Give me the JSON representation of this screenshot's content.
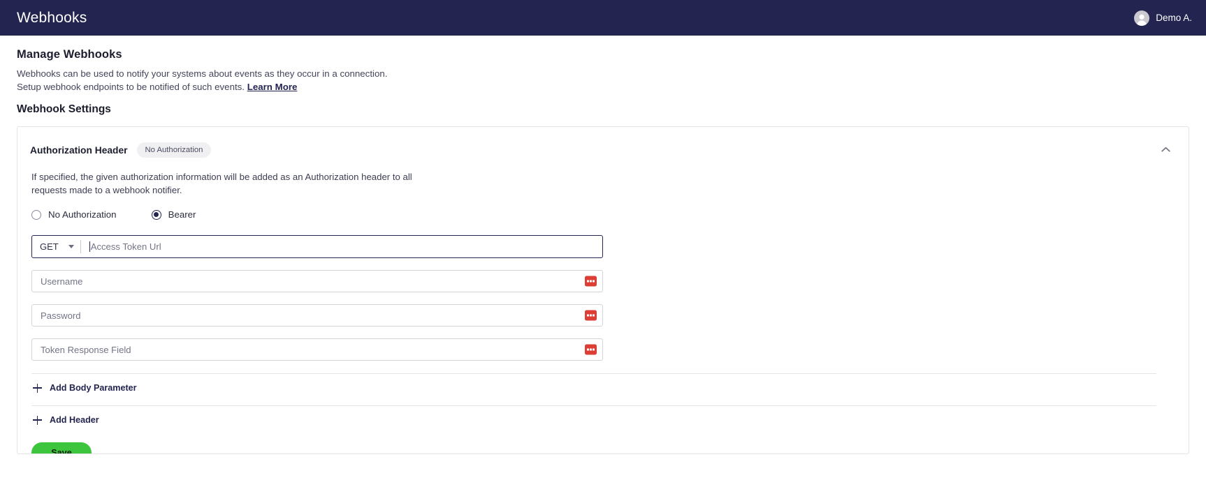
{
  "topbar": {
    "title": "Webhooks",
    "avatar_icon": "user-avatar-icon",
    "username": "Demo A."
  },
  "page": {
    "title": "Manage Webhooks",
    "description_line1": "Webhooks can be used to notify your systems about events as they occur in a connection.",
    "description_line2": "Setup webhook endpoints to be notified of such events.",
    "learn_more_label": "Learn More",
    "section_title": "Webhook Settings"
  },
  "card": {
    "title": "Authorization Header",
    "badge": "No Authorization",
    "collapse_icon": "chevron-up-icon",
    "description": "If specified, the given authorization information will be added as an Authorization header to all requests made to a webhook notifier.",
    "radios": [
      {
        "label": "No Authorization",
        "checked": false
      },
      {
        "label": "Bearer",
        "checked": true
      }
    ],
    "method": {
      "value": "GET",
      "caret_icon": "chevron-down-icon"
    },
    "fields": [
      {
        "placeholder": "Access Token Url",
        "value": "",
        "has_password_icon": false,
        "focused": true
      },
      {
        "placeholder": "Username",
        "value": "",
        "has_password_icon": true,
        "focused": false
      },
      {
        "placeholder": "Password",
        "value": "",
        "has_password_icon": true,
        "focused": false
      },
      {
        "placeholder": "Token Response Field",
        "value": "",
        "has_password_icon": true,
        "focused": false
      }
    ],
    "password_manager_icon": "password-manager-icon",
    "add_body_parameter_label": "Add Body Parameter",
    "add_header_label": "Add Header",
    "save_label": "Save"
  },
  "colors": {
    "navy": "#232550",
    "green": "#3dc63d",
    "red": "#dc3d34",
    "badge_bg": "#f0f0f2"
  }
}
